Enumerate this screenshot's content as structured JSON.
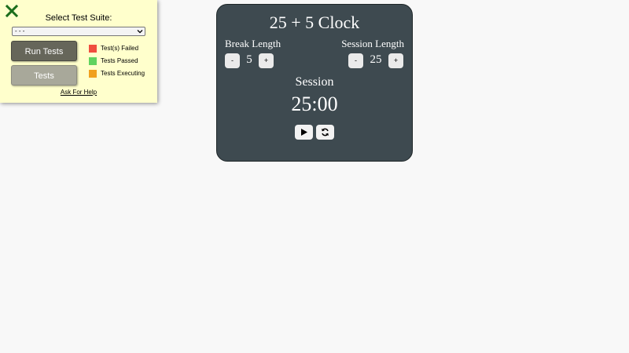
{
  "test_panel": {
    "title": "Select Test Suite:",
    "select_value": "- - -",
    "run_label": "Run Tests",
    "tests_label": "Tests",
    "legend": [
      {
        "label": "Test(s) Failed",
        "color": "#f04e3e"
      },
      {
        "label": "Tests Passed",
        "color": "#5fd35f"
      },
      {
        "label": "Tests Executing",
        "color": "#f0a01e"
      }
    ],
    "help_label": "Ask For Help",
    "close_icon": "close-x-icon",
    "close_color": "#1b6d1b"
  },
  "clock": {
    "title": "25 + 5 Clock",
    "break_label": "Break Length",
    "break_value": "5",
    "session_label": "Session Length",
    "session_value": "25",
    "decrement_label": "-",
    "increment_label": "+",
    "timer_label": "Session",
    "time_left": "25:00",
    "play_icon": "play-icon",
    "reset_icon": "refresh-icon",
    "background": "#3e4a50"
  }
}
